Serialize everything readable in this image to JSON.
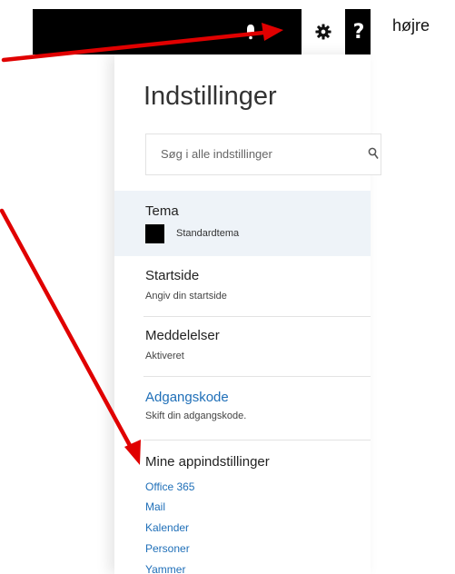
{
  "topbar": {
    "bell_icon": "bell-icon",
    "gear_icon": "gear-icon",
    "help_label": "?"
  },
  "side_text": "højre",
  "panel": {
    "title": "Indstillinger",
    "search": {
      "placeholder": "Søg i alle indstillinger",
      "icon": "search-icon"
    },
    "theme": {
      "heading": "Tema",
      "value": "Standardtema",
      "swatch_color": "#000000"
    },
    "start_page": {
      "heading": "Startside",
      "sub": "Angiv din startside"
    },
    "notifications": {
      "heading": "Meddelelser",
      "sub": "Aktiveret"
    },
    "password": {
      "heading": "Adgangskode",
      "sub": "Skift din adgangskode."
    },
    "apps": {
      "heading": "Mine appindstillinger",
      "links": [
        "Office 365",
        "Mail",
        "Kalender",
        "Personer",
        "Yammer"
      ]
    }
  },
  "colors": {
    "link": "#1f6fb8",
    "arrow": "#e00000",
    "topbar": "#000000",
    "theme_highlight": "#eef3f8"
  }
}
